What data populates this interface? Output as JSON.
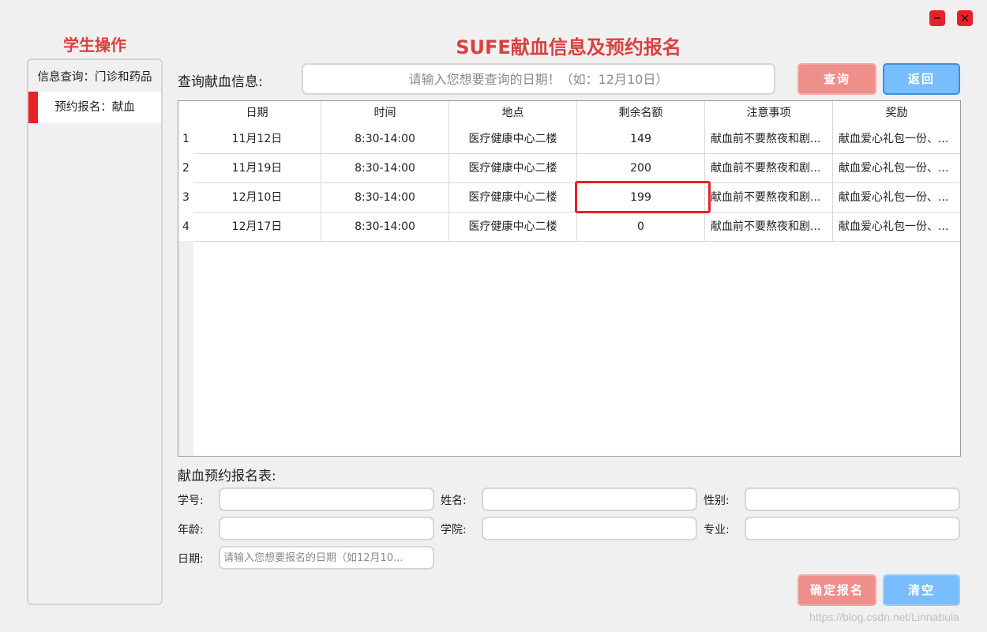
{
  "window": {
    "minimize_icon": "minimize-icon",
    "close_icon": "close-icon",
    "accent_color": "#e8202a"
  },
  "sidebar": {
    "title": "学生操作",
    "items": [
      {
        "label": "信息查询：门诊和药品",
        "active": false
      },
      {
        "label": "预约报名：献血",
        "active": true
      }
    ]
  },
  "header": {
    "title": "SUFE献血信息及预约报名",
    "title_color": "#d9413f"
  },
  "search": {
    "label": "查询献血信息:",
    "placeholder": "请输入您想要查询的日期！（如：12月10日）",
    "query_button": "查询",
    "back_button": "返回"
  },
  "table": {
    "columns": [
      "日期",
      "时间",
      "地点",
      "剩余名额",
      "注意事项",
      "奖励"
    ],
    "rows": [
      {
        "num": "1",
        "cells": [
          "11月12日",
          "8:30-14:00",
          "医疗健康中心二楼",
          "149",
          "献血前不要熬夜和剧...",
          "献血爱心礼包一份、..."
        ]
      },
      {
        "num": "2",
        "cells": [
          "11月19日",
          "8:30-14:00",
          "医疗健康中心二楼",
          "200",
          "献血前不要熬夜和剧...",
          "献血爱心礼包一份、..."
        ]
      },
      {
        "num": "3",
        "cells": [
          "12月10日",
          "8:30-14:00",
          "医疗健康中心二楼",
          "199",
          "献血前不要熬夜和剧...",
          "献血爱心礼包一份、..."
        ]
      },
      {
        "num": "4",
        "cells": [
          "12月17日",
          "8:30-14:00",
          "医疗健康中心二楼",
          "0",
          "献血前不要熬夜和剧...",
          "献血爱心礼包一份、..."
        ]
      }
    ]
  },
  "form": {
    "title": "献血预约报名表:",
    "fields": {
      "student_id": {
        "label": "学号:",
        "value": ""
      },
      "name": {
        "label": "姓名:",
        "value": ""
      },
      "gender": {
        "label": "性别:",
        "value": ""
      },
      "age": {
        "label": "年龄:",
        "value": ""
      },
      "college": {
        "label": "学院:",
        "value": ""
      },
      "major": {
        "label": "专业:",
        "value": ""
      },
      "date": {
        "label": "日期:",
        "value": "",
        "placeholder": "请输入您想要报名的日期（如12月10..."
      }
    },
    "confirm_button": "确定报名",
    "clear_button": "清空"
  },
  "watermark": "https://blog.csdn.net/Linnabula"
}
